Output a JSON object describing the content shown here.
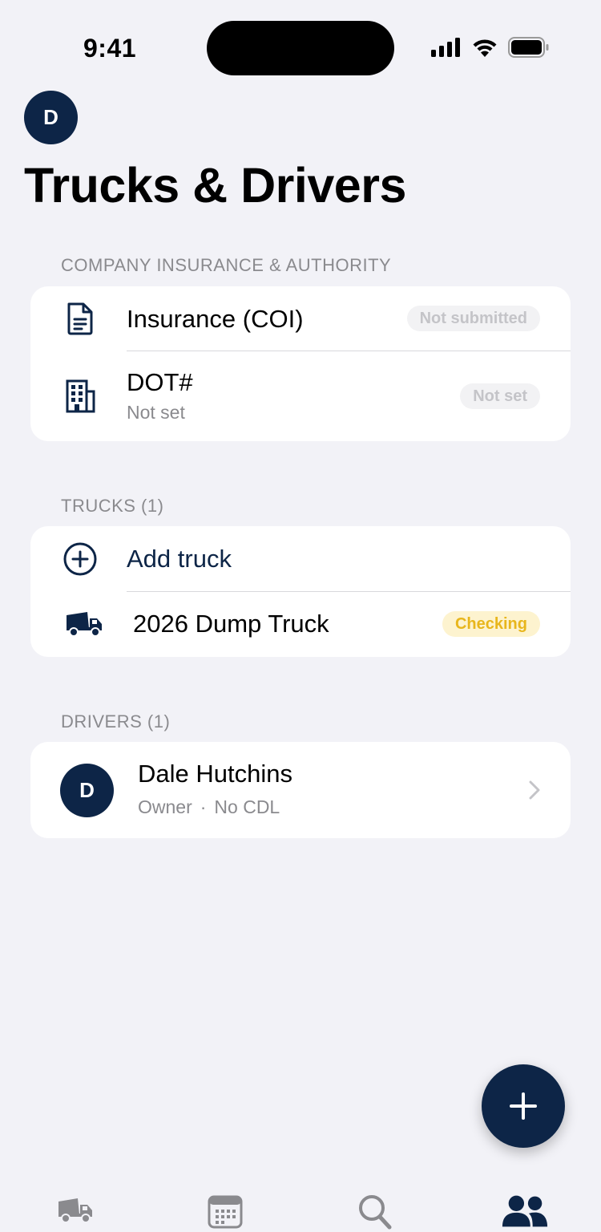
{
  "status_bar": {
    "time": "9:41"
  },
  "header": {
    "avatar_initial": "D",
    "title": "Trucks & Drivers"
  },
  "sections": {
    "company": {
      "header": "COMPANY INSURANCE & AUTHORITY",
      "rows": [
        {
          "icon": "document-icon",
          "title": "Insurance (COI)",
          "badge": "Not submitted"
        },
        {
          "icon": "building-icon",
          "title": "DOT#",
          "subtitle": "Not set",
          "badge": "Not set"
        }
      ]
    },
    "trucks": {
      "header": "TRUCKS (1)",
      "add_label": "Add truck",
      "items": [
        {
          "icon": "dump-truck-icon",
          "title": "2026 Dump Truck",
          "badge": "Checking"
        }
      ]
    },
    "drivers": {
      "header": "DRIVERS (1)",
      "items": [
        {
          "initial": "D",
          "name": "Dale Hutchins",
          "role": "Owner",
          "separator": "·",
          "license": "No CDL"
        }
      ]
    }
  },
  "tabbar": {
    "tabs": [
      {
        "icon": "truck-tab-icon",
        "active": false
      },
      {
        "icon": "calendar-tab-icon",
        "active": false
      },
      {
        "icon": "search-tab-icon",
        "active": false
      },
      {
        "icon": "people-tab-icon",
        "active": true
      }
    ]
  },
  "colors": {
    "navy": "#0d2547",
    "background": "#f2f2f7",
    "checking_text": "#e8b61c",
    "checking_bg": "#fdf3cf",
    "muted": "#8a8a8e"
  }
}
